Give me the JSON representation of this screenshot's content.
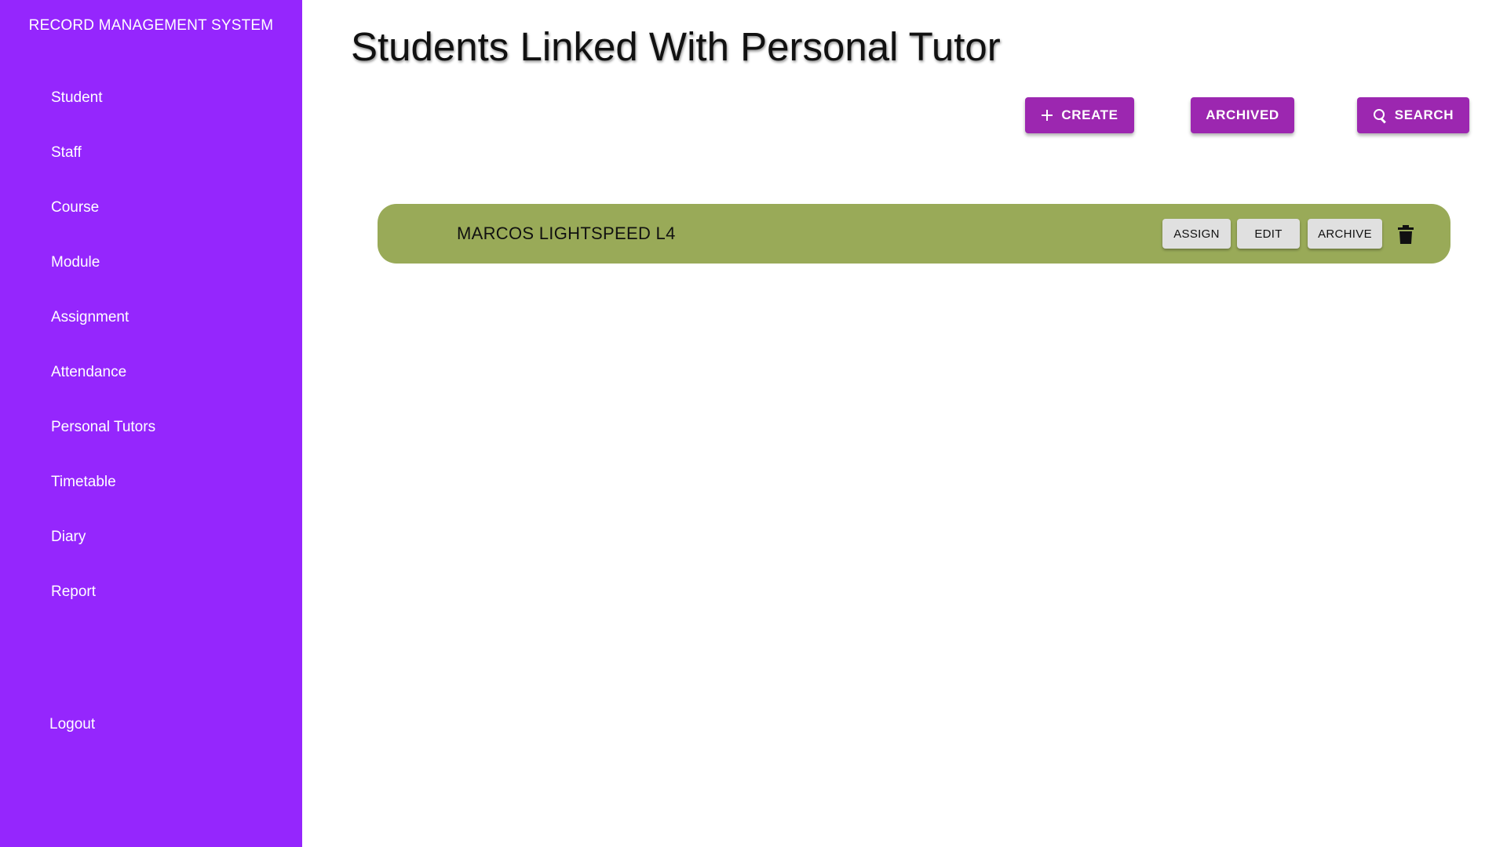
{
  "sidebar": {
    "app_title": "RECORD MANAGEMENT SYSTEM",
    "items": [
      {
        "label": "Student"
      },
      {
        "label": "Staff"
      },
      {
        "label": "Course"
      },
      {
        "label": "Module"
      },
      {
        "label": "Assignment"
      },
      {
        "label": "Attendance"
      },
      {
        "label": "Personal Tutors"
      },
      {
        "label": "Timetable"
      },
      {
        "label": "Diary"
      },
      {
        "label": "Report"
      }
    ],
    "logout_label": "Logout"
  },
  "main": {
    "title": "Students Linked With Personal Tutor",
    "toolbar": {
      "create_label": "CREATE",
      "archived_label": "ARCHIVED",
      "search_label": "SEARCH"
    },
    "records": [
      {
        "name": "MARCOS LIGHTSPEED L4",
        "assign_label": "ASSIGN",
        "edit_label": "EDIT",
        "archive_label": "ARCHIVE"
      }
    ]
  },
  "colors": {
    "sidebar_bg": "#9526fd",
    "primary_button": "#9c27b0",
    "record_row_bg": "#99aa58",
    "secondary_button": "#e0e0e0"
  },
  "icons": {
    "create": "plus-icon",
    "search": "search-icon",
    "delete": "trash-icon"
  }
}
